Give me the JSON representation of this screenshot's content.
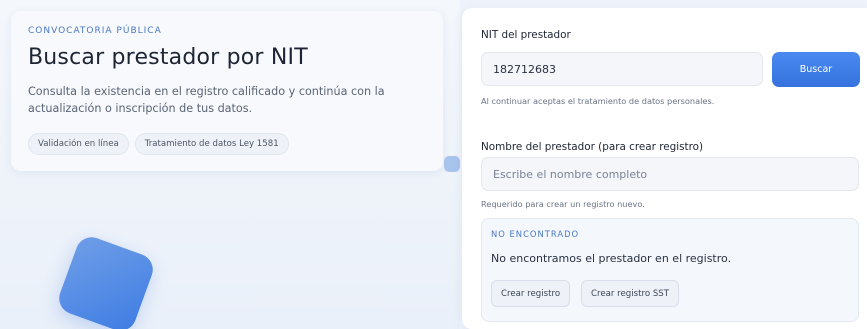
{
  "hero": {
    "eyebrow": "CONVOCATORIA PÚBLICA",
    "title": "Buscar prestador por NIT",
    "description": "Consulta la existencia en el registro calificado y continúa con la actualización o inscripción de tus datos.",
    "chips": [
      "Validación en línea",
      "Tratamiento de datos Ley 1581"
    ]
  },
  "form": {
    "nit_label": "NIT del prestador",
    "nit_value": "182712683",
    "search_button": "Buscar",
    "consent_hint": "Al continuar aceptas el tratamiento de datos personales.",
    "name_label": "Nombre del prestador (para crear registro)",
    "name_placeholder": "Escribe el nombre completo",
    "name_hint": "Requerido para crear un registro nuevo."
  },
  "result": {
    "status_tag": "NO ENCONTRADO",
    "message": "No encontramos el prestador en el registro.",
    "actions": [
      "Crear registro",
      "Crear registro SST"
    ]
  },
  "colors": {
    "accent": "#3572de",
    "eyebrow": "#4a78c4",
    "background": "#eef3fb"
  }
}
